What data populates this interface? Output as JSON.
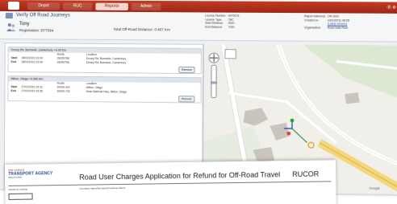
{
  "window": {
    "tabs": [
      {
        "label": "Depot",
        "active": false
      },
      {
        "label": "RUC",
        "active": false
      },
      {
        "label": "Reports",
        "active": true
      },
      {
        "label": "Admin",
        "active": false
      }
    ],
    "right_label": "Ⓡ ⚙"
  },
  "header": {
    "title": "Verify Off Road Journeys",
    "name": "Tony",
    "registration": "Registration: EFT564",
    "total_distance": "Total Off-Road Distance: 0.467 Km",
    "details_left": [
      {
        "key": "Licence Number:",
        "value": "0070076"
      },
      {
        "key": "Licence Type:",
        "value": "TBC"
      },
      {
        "key": "Start Distance:",
        "value": "0020"
      },
      {
        "key": "End Distance:",
        "value": "7020"
      }
    ],
    "details_right": [
      {
        "key": "Report reference:",
        "value": "OR 2020"
      },
      {
        "key": "Created on:",
        "value": "23/10/2011 08:55"
      },
      {
        "key": "",
        "value": "(Latest version)"
      },
      {
        "key": "Organisation:",
        "value": "Road Safe Fleet"
      }
    ]
  },
  "trips": [
    {
      "header": "Dovey Rd, Burnside, Canterbury +0.26 Km",
      "col_route": "Route",
      "col_location": "Location",
      "rows": [
        {
          "label": "Start",
          "time": "28/01/2010 23:00",
          "route": "28/05/766",
          "location": "Dovey Rd, Burnside, Canterbury"
        },
        {
          "label": "End",
          "time": "28/01/2010 23:00",
          "route": "28/05/766",
          "location": "Dovey Rd, Burnside, Canterbury"
        }
      ],
      "button": "Remove"
    },
    {
      "header": "Milton, Otago +0.065 Km",
      "col_route": "Route",
      "col_location": "Location",
      "rows": [
        {
          "label": "Start",
          "time": "27/01/2010 19:31",
          "route": "20094.041",
          "location": "Milton, Otago"
        },
        {
          "label": "End",
          "time": "27/01/2010 19:35",
          "route": "20093.724",
          "location": "Near Waihola Hwy, Milton, Otago"
        }
      ],
      "button": "Remove"
    }
  ],
  "map": {
    "road_color": "#ffffff",
    "route_color": "#f2cf5a",
    "building_color": "#c9c4bd",
    "green_color": "#cfe3c4",
    "attribution": "Google"
  },
  "document": {
    "agency_top": "new zealand",
    "agency_main": "TRANSPORT AGENCY",
    "agency_sub": "WAKA KOTAHI",
    "title": "Road User Charges Application for Refund for Off-Road Travel",
    "code": "RUCOR",
    "field_label": "Company name/Surname/Customer Name",
    "left_label": "Customer number"
  },
  "colors": {
    "topbar": "#b3321c",
    "accent": "#31466e",
    "agency_blue": "#1b4c8a"
  }
}
